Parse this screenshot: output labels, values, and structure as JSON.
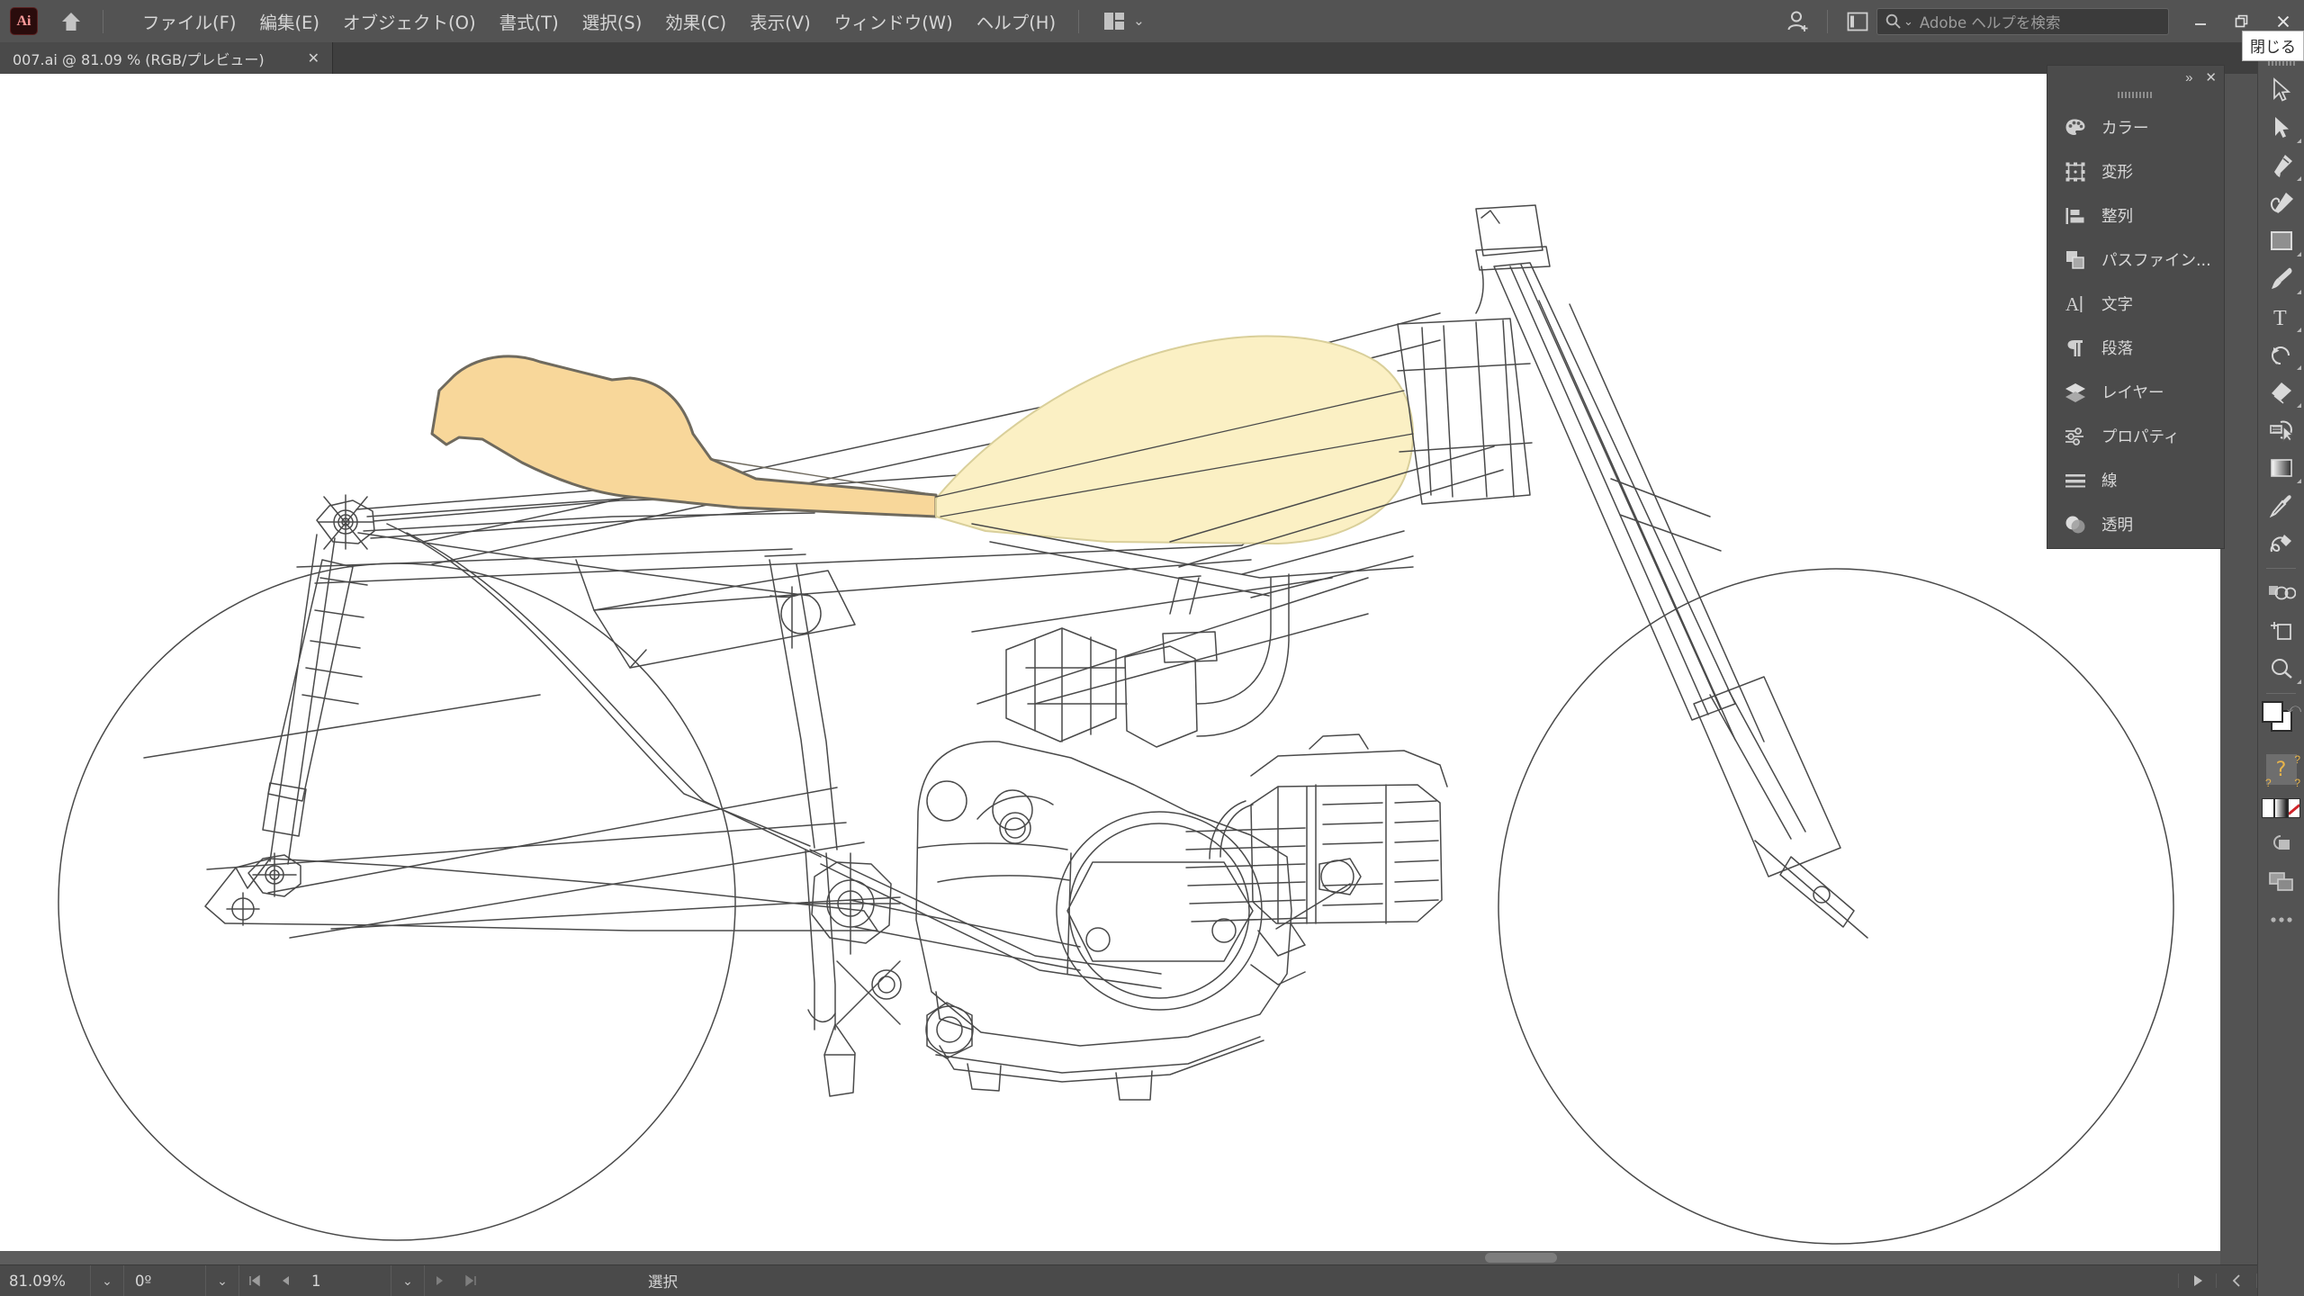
{
  "app": {
    "logo_label": "Ai",
    "home_icon": "home-icon"
  },
  "menubar": {
    "items": [
      {
        "label": "ファイル(F)",
        "name": "menu-file"
      },
      {
        "label": "編集(E)",
        "name": "menu-edit"
      },
      {
        "label": "オブジェクト(O)",
        "name": "menu-object"
      },
      {
        "label": "書式(T)",
        "name": "menu-type"
      },
      {
        "label": "選択(S)",
        "name": "menu-select"
      },
      {
        "label": "効果(C)",
        "name": "menu-effect"
      },
      {
        "label": "表示(V)",
        "name": "menu-view"
      },
      {
        "label": "ウィンドウ(W)",
        "name": "menu-window"
      },
      {
        "label": "ヘルプ(H)",
        "name": "menu-help"
      }
    ],
    "workspace_switcher": "workspace-switcher-icon",
    "profile_icon": "user-add-icon",
    "panel_toggle_icon": "panel-toggle-icon"
  },
  "search": {
    "placeholder": "Adobe ヘルプを検索",
    "icon": "search-icon"
  },
  "window_controls": {
    "minimize": "minimize-icon",
    "restore": "restore-icon",
    "close": "close-icon",
    "tooltip": "閉じる"
  },
  "document_tab": {
    "title": "007.ai @ 81.09 % (RGB/プレビュー)",
    "close": "✕"
  },
  "panel_dock": {
    "collapse_label": "»",
    "close_label": "✕",
    "items": [
      {
        "label": "カラー",
        "icon": "color-palette-icon"
      },
      {
        "label": "変形",
        "icon": "transform-icon"
      },
      {
        "label": "整列",
        "icon": "align-icon"
      },
      {
        "label": "パスファイン...",
        "icon": "pathfinder-icon"
      },
      {
        "label": "文字",
        "icon": "character-icon"
      },
      {
        "label": "段落",
        "icon": "paragraph-icon"
      },
      {
        "label": "レイヤー",
        "icon": "layers-icon"
      },
      {
        "label": "プロパティ",
        "icon": "properties-icon"
      },
      {
        "label": "線",
        "icon": "stroke-icon"
      },
      {
        "label": "透明",
        "icon": "transparency-icon"
      }
    ]
  },
  "toolbar": {
    "collapse_label": "«",
    "tools": [
      {
        "name": "selection-tool-icon",
        "has_flyout": false,
        "selected": false
      },
      {
        "name": "direct-selection-tool-icon",
        "has_flyout": true,
        "selected": false
      },
      {
        "name": "pen-tool-icon",
        "has_flyout": true,
        "selected": false
      },
      {
        "name": "curvature-tool-icon",
        "has_flyout": false,
        "selected": false
      },
      {
        "name": "rectangle-tool-icon",
        "has_flyout": true,
        "selected": false
      },
      {
        "name": "paintbrush-tool-icon",
        "has_flyout": true,
        "selected": false
      },
      {
        "name": "type-tool-icon",
        "has_flyout": true,
        "selected": false
      },
      {
        "name": "rotate-tool-icon",
        "has_flyout": true,
        "selected": false
      },
      {
        "name": "eraser-tool-icon",
        "has_flyout": true,
        "selected": false
      },
      {
        "name": "shaper-tool-icon",
        "has_flyout": false,
        "selected": false
      },
      {
        "name": "gradient-tool-icon",
        "has_flyout": true,
        "selected": false
      },
      {
        "name": "eyedropper-tool-icon",
        "has_flyout": false,
        "selected": false
      },
      {
        "name": "blend-tool-icon",
        "has_flyout": false,
        "selected": false
      },
      {
        "name": "symbol-sprayer-tool-icon",
        "has_flyout": false,
        "selected": false
      },
      {
        "name": "artboard-tool-icon",
        "has_flyout": false,
        "selected": false
      },
      {
        "name": "zoom-tool-icon",
        "has_flyout": true,
        "selected": false
      }
    ],
    "question_label": "?",
    "draw_mode_icon": "draw-mode-icon",
    "screen_mode_icon": "screen-mode-icon",
    "edit_toolbar_icon": "edit-toolbar-ellipsis-icon"
  },
  "statusbar": {
    "zoom": "81.09%",
    "rotation": "0º",
    "page": "1",
    "tool_status": "選択",
    "first_icon": "first-page-icon",
    "prev_icon": "prev-page-icon",
    "next_icon": "next-page-icon",
    "last_icon": "last-page-icon",
    "play_icon": "play-icon",
    "collapse_icon": "collapse-left-icon"
  },
  "artwork": {
    "title": "motorcycle-technical-drawing",
    "colors": {
      "seat_fill": "#f8d79a",
      "seat_stroke": "#6f6a5e",
      "tank_fill": "#fbf0c4",
      "tank_stroke": "#d9cf9a",
      "line": "#4a4a4a",
      "background": "#ffffff"
    }
  }
}
